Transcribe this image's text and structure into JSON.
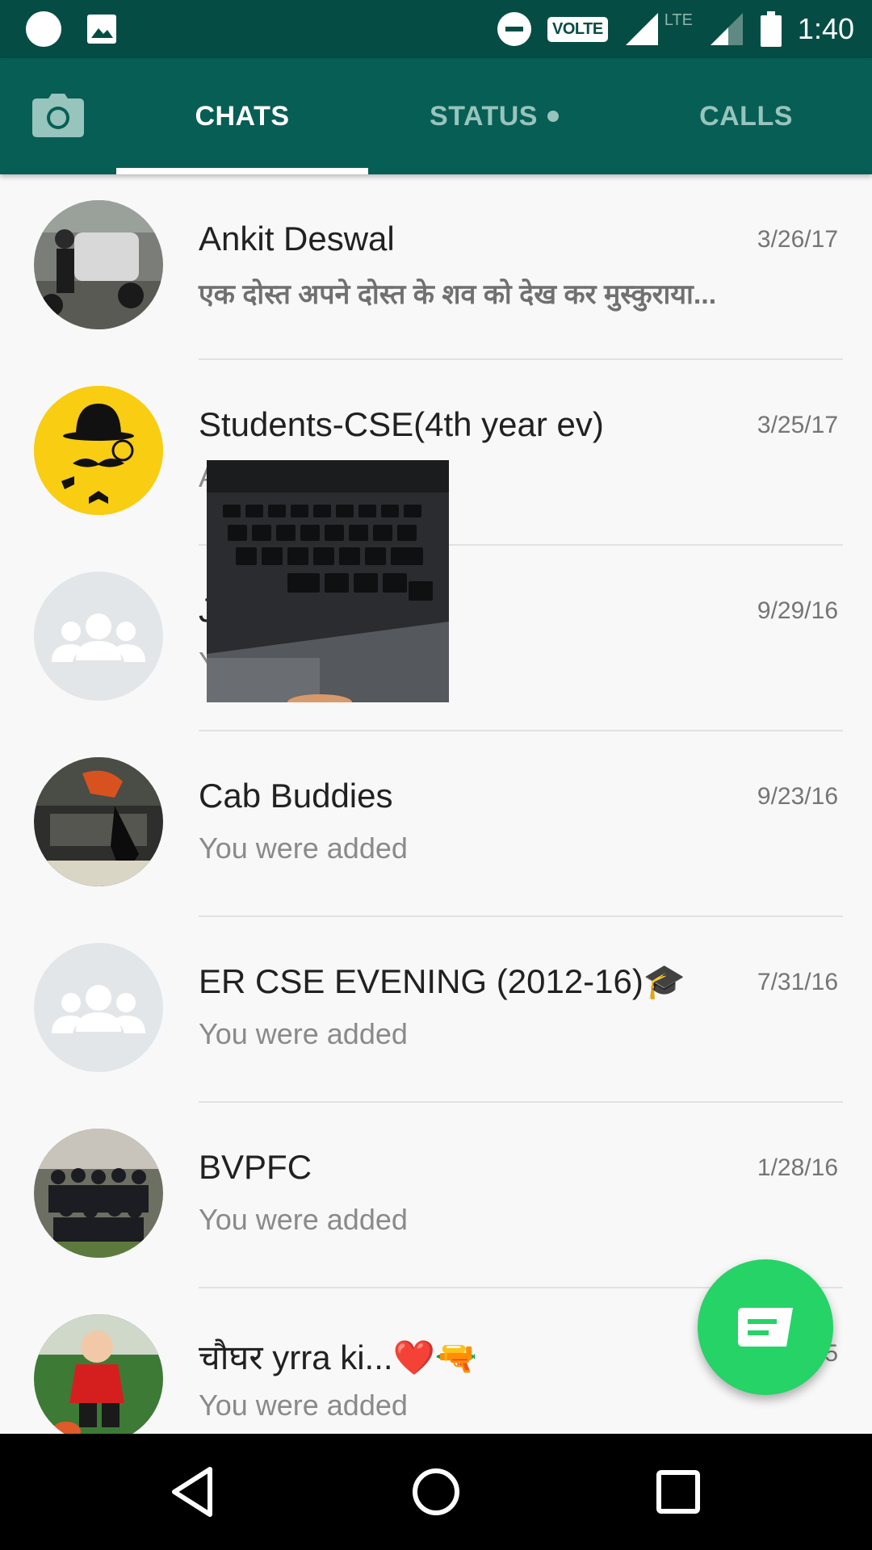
{
  "status_bar": {
    "time": "1:40",
    "volte": "VOLTE",
    "network": "LTE"
  },
  "tabs": [
    {
      "label": "CHATS",
      "active": true
    },
    {
      "label": "STATUS",
      "active": false,
      "has_dot": true
    },
    {
      "label": "CALLS",
      "active": false
    }
  ],
  "chats": [
    {
      "name": "Ankit Deswal",
      "date": "3/26/17",
      "message": "एक दोस्त अपने दोस्त के शव को देख कर मुस्कुराया..."
    },
    {
      "name": "Students-CSE(4th year ev)",
      "date": "3/25/17",
      "message": "A"
    },
    {
      "name": "J",
      "date": "9/29/16",
      "message": "Y"
    },
    {
      "name": "Cab Buddies",
      "date": "9/23/16",
      "message": "You were added"
    },
    {
      "name": "ER CSE EVENING (2012-16)🎓",
      "date": "7/31/16",
      "message": "You were added"
    },
    {
      "name": "BVPFC",
      "date": "1/28/16",
      "message": "You were added"
    },
    {
      "name": "चौघर yrra ki...❤️🔫",
      "date": "5",
      "message": "You were added"
    }
  ],
  "colors": {
    "status_bar": "#054d44",
    "toolbar": "#075e54",
    "fab": "#25d366",
    "inactive_tab": "#97c4bd"
  },
  "icons": {
    "camera": "camera-icon",
    "fab": "new-chat-icon",
    "nav_back": "back-triangle-icon",
    "nav_home": "home-circle-icon",
    "nav_recents": "recents-square-icon"
  }
}
